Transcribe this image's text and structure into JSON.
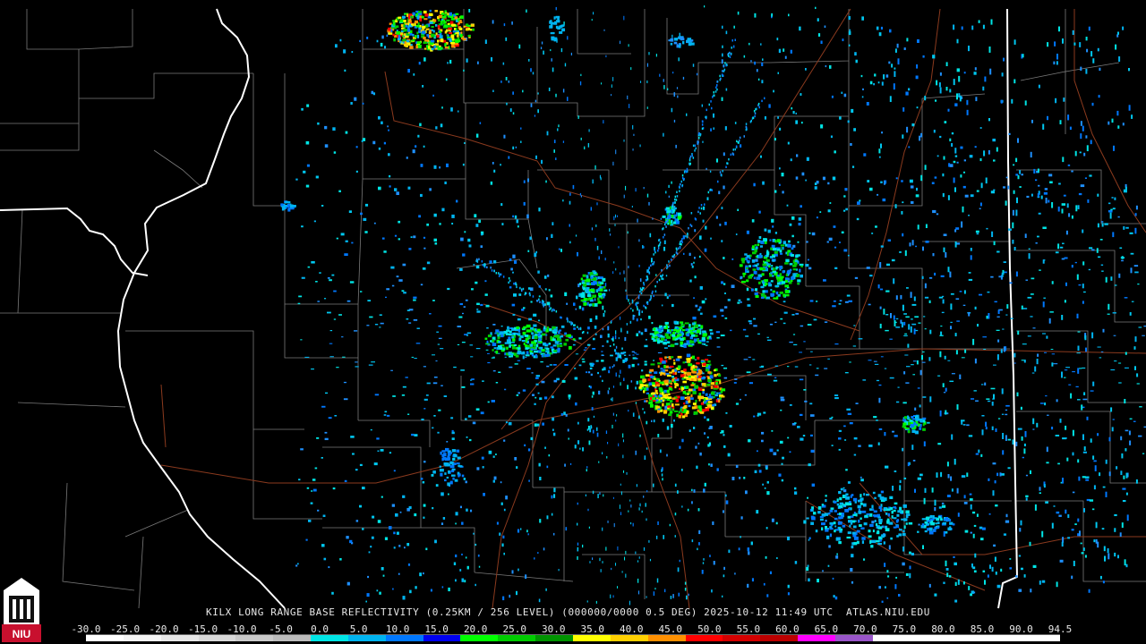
{
  "product": {
    "caption": "KILX LONG RANGE BASE REFLECTIVITY (0.25KM / 256 LEVEL) (000000/0000 0.5 DEG) 2025-10-12 11:49 UTC  ATLAS.NIU.EDU",
    "station": "KILX",
    "valid_time": "2025-10-12 11:49 UTC",
    "source": "ATLAS.NIU.EDU"
  },
  "logo": {
    "text": "NIU"
  },
  "scale": {
    "labels": [
      "-30.0",
      "-25.0",
      "-20.0",
      "-15.0",
      "-10.0",
      "-5.0",
      "0.0",
      "5.0",
      "10.0",
      "15.0",
      "20.0",
      "25.0",
      "30.0",
      "35.0",
      "40.0",
      "45.0",
      "50.0",
      "55.0",
      "60.0",
      "65.0",
      "70.0",
      "75.0",
      "80.0",
      "85.0",
      "90.0",
      "94.5"
    ],
    "colors": [
      "#ffffff",
      "#f4f4f4",
      "#e6e6e6",
      "#d8d8d8",
      "#cacaca",
      "#bcbcbc",
      "#00e5e5",
      "#00b4f0",
      "#0078ff",
      "#0000f0",
      "#00ff00",
      "#00cc00",
      "#009400",
      "#ffff00",
      "#ffd000",
      "#ff9000",
      "#ff0000",
      "#d40000",
      "#bc0000",
      "#ff00ff",
      "#9955c9",
      "#ffffff",
      "#ffffff",
      "#ffffff",
      "#ffffff",
      "#ffffff"
    ]
  },
  "colors": {
    "background": "#000000",
    "county_lines": "#7a7a7a",
    "state_lines": "#ffffff",
    "highways": "#8b3a1e"
  }
}
